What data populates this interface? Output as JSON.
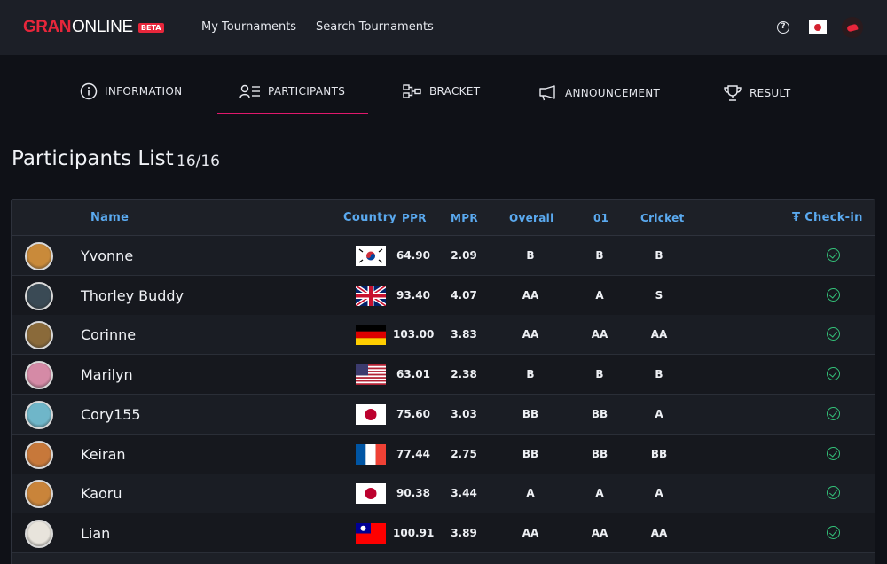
{
  "header": {
    "logo_gran": "GRAN",
    "logo_online": "ONLINE",
    "logo_badge": "BETA",
    "nav": [
      "My Tournaments",
      "Search Tournaments"
    ],
    "help_icon": "question-circle-icon",
    "language_flag": "japan-flag",
    "user_icon": "user-avatar-icon"
  },
  "tabs": [
    {
      "label": "INFORMATION",
      "icon": "info-circle-icon"
    },
    {
      "label": "PARTICIPANTS",
      "icon": "participants-list-icon",
      "active": true
    },
    {
      "label": "BRACKET",
      "icon": "bracket-icon"
    },
    {
      "label": "ANNOUNCEMENT",
      "icon": "megaphone-icon"
    },
    {
      "label": "RESULT",
      "icon": "trophy-icon"
    }
  ],
  "page": {
    "title": "Participants List",
    "count": "16/16"
  },
  "table": {
    "columns": {
      "name": "Name",
      "country": "Country",
      "ppr": "PPR",
      "mpr": "MPR",
      "overall": "Overall",
      "o1": "01",
      "cricket": "Cricket",
      "checkin": "Check-in",
      "checkin_icon": "₮"
    },
    "rows": [
      {
        "name": "Yvonne",
        "country": "kr",
        "ppr": "64.90",
        "mpr": "2.09",
        "overall": "B",
        "o1": "B",
        "cricket": "B",
        "checked_in": true
      },
      {
        "name": "Thorley Buddy",
        "country": "gb",
        "ppr": "93.40",
        "mpr": "4.07",
        "overall": "AA",
        "o1": "A",
        "cricket": "S",
        "checked_in": true
      },
      {
        "name": "Corinne",
        "country": "de",
        "ppr": "103.00",
        "mpr": "3.83",
        "overall": "AA",
        "o1": "AA",
        "cricket": "AA",
        "checked_in": true
      },
      {
        "name": "Marilyn",
        "country": "us",
        "ppr": "63.01",
        "mpr": "2.38",
        "overall": "B",
        "o1": "B",
        "cricket": "B",
        "checked_in": true
      },
      {
        "name": "Cory155",
        "country": "jp",
        "ppr": "75.60",
        "mpr": "3.03",
        "overall": "BB",
        "o1": "BB",
        "cricket": "A",
        "checked_in": true
      },
      {
        "name": "Keiran",
        "country": "fr",
        "ppr": "77.44",
        "mpr": "2.75",
        "overall": "BB",
        "o1": "BB",
        "cricket": "BB",
        "checked_in": true
      },
      {
        "name": "Kaoru",
        "country": "jp",
        "ppr": "90.38",
        "mpr": "3.44",
        "overall": "A",
        "o1": "A",
        "cricket": "A",
        "checked_in": true
      },
      {
        "name": "Lian",
        "country": "tw",
        "ppr": "100.91",
        "mpr": "3.89",
        "overall": "AA",
        "o1": "AA",
        "cricket": "AA",
        "checked_in": true
      }
    ]
  },
  "colors": {
    "accent": "#e0186c",
    "brand": "#e8263b",
    "header_text": "#5aa9ef",
    "check": "#34c37a"
  }
}
